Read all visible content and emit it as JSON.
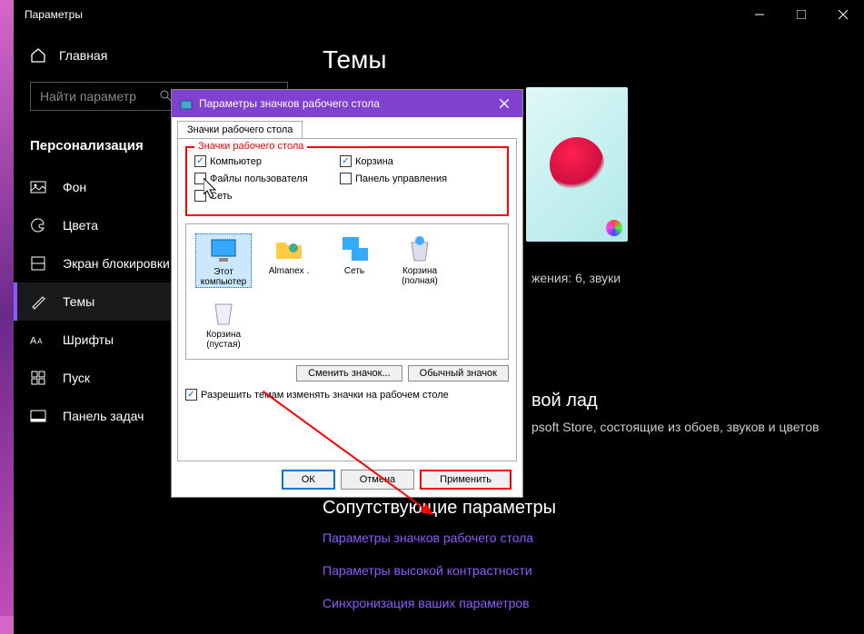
{
  "window": {
    "title": "Параметры"
  },
  "sidebar": {
    "home": "Главная",
    "search_placeholder": "Найти параметр",
    "section": "Персонализация",
    "items": [
      {
        "label": "Фон",
        "icon": "image"
      },
      {
        "label": "Цвета",
        "icon": "palette"
      },
      {
        "label": "Экран блокировки",
        "icon": "lock"
      },
      {
        "label": "Темы",
        "icon": "brush"
      },
      {
        "label": "Шрифты",
        "icon": "font"
      },
      {
        "label": "Пуск",
        "icon": "start"
      },
      {
        "label": "Панель задач",
        "icon": "taskbar"
      }
    ]
  },
  "content": {
    "heading": "Темы",
    "theme_meta": "жения: 6, звуки",
    "more_h": "вой лад",
    "more_p": "psoft Store, состоящие из обоев, звуков и цветов",
    "related_h": "Сопутствующие параметры",
    "links": [
      "Параметры значков рабочего стола",
      "Параметры высокой контрастности",
      "Синхронизация ваших параметров"
    ]
  },
  "dialog": {
    "title": "Параметры значков рабочего стола",
    "tab": "Значки рабочего стола",
    "fieldset_legend": "Значки рабочего стола",
    "checks": {
      "computer": {
        "label": "Компьютер",
        "checked": true
      },
      "recycle": {
        "label": "Корзина",
        "checked": true
      },
      "userfiles": {
        "label": "Файлы пользователя",
        "checked": false
      },
      "control": {
        "label": "Панель управления",
        "checked": false
      },
      "network": {
        "label": "Сеть",
        "checked": false
      }
    },
    "icons": [
      {
        "label": "Этот компьютер"
      },
      {
        "label": "Almanex ."
      },
      {
        "label": "Сеть"
      },
      {
        "label": "Корзина (полная)"
      },
      {
        "label": "Корзина (пустая)"
      }
    ],
    "change_icon": "Сменить значок...",
    "default_icon": "Обычный значок",
    "allow_themes": "Разрешить темам изменять значки на рабочем столе",
    "ok": "ОК",
    "cancel": "Отмена",
    "apply": "Применить"
  }
}
